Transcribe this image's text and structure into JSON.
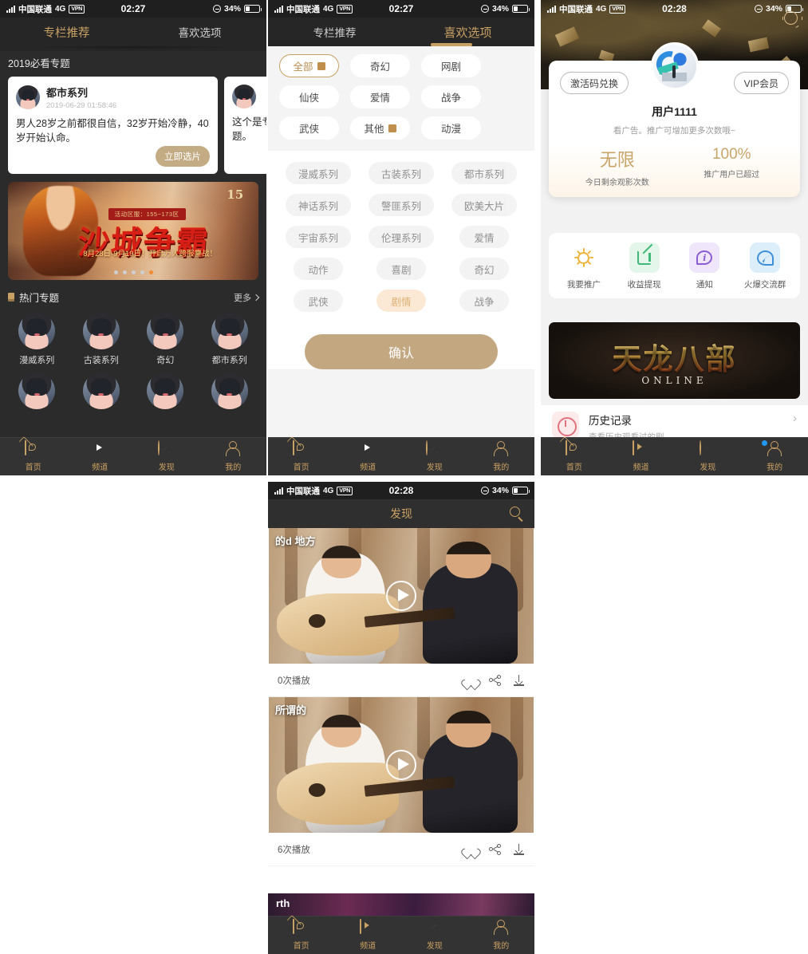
{
  "status_bar": {
    "carrier": "中国联通",
    "network": "4G",
    "vpn": "VPN",
    "time_227": "02:27",
    "time_228": "02:28",
    "battery": "34%"
  },
  "screen_home": {
    "tabs": [
      {
        "label": "专栏推荐",
        "active": true
      },
      {
        "label": "喜欢选项",
        "active": false
      }
    ],
    "section_title": "2019必看专题",
    "cards": [
      {
        "title": "都市系列",
        "date": "2019-06-29 01:58:46",
        "body": "男人28岁之前都很自信，32岁开始冷静，40岁开始认命。",
        "button": "立即选片"
      },
      {
        "body": "这个是专题。"
      }
    ],
    "banner": {
      "ribbon": "活动区服：155~173区",
      "title": "沙城争霸",
      "subtitle": "8月28日-9月19日！开启万人跨服鏖战！",
      "corner": "15",
      "dots": 5,
      "active_dot": 5
    },
    "hot_section": {
      "title": "热门专题",
      "more": "更多"
    },
    "hot_items": [
      {
        "label": "漫威系列"
      },
      {
        "label": "古装系列"
      },
      {
        "label": "奇幻"
      },
      {
        "label": "都市系列"
      }
    ],
    "nav": [
      {
        "label": "首页",
        "icon": "home-icon",
        "active": false
      },
      {
        "label": "频道",
        "icon": "channel-icon",
        "active": true
      },
      {
        "label": "发现",
        "icon": "discover-icon",
        "active": false
      },
      {
        "label": "我的",
        "icon": "profile-icon",
        "active": false
      }
    ]
  },
  "screen_prefs": {
    "tabs": [
      {
        "label": "专栏推荐",
        "active": false
      },
      {
        "label": "喜欢选项",
        "active": true
      }
    ],
    "top_chips": [
      {
        "label": "全部",
        "selected": true,
        "has_square": true
      },
      {
        "label": "奇幻",
        "selected": false,
        "has_square": false
      },
      {
        "label": "网剧",
        "selected": false,
        "has_square": false
      },
      {
        "label": "仙侠",
        "selected": false,
        "has_square": false
      },
      {
        "label": "爱情",
        "selected": false,
        "has_square": false
      },
      {
        "label": "战争",
        "selected": false,
        "has_square": false
      },
      {
        "label": "武侠",
        "selected": false,
        "has_square": false
      },
      {
        "label": "其他",
        "selected": false,
        "has_square": true
      },
      {
        "label": "动漫",
        "selected": false,
        "has_square": false
      }
    ],
    "body_chips": [
      {
        "label": "漫威系列",
        "selected": false
      },
      {
        "label": "古装系列",
        "selected": false
      },
      {
        "label": "都市系列",
        "selected": false
      },
      {
        "label": "神话系列",
        "selected": false
      },
      {
        "label": "警匪系列",
        "selected": false
      },
      {
        "label": "欧美大片",
        "selected": false
      },
      {
        "label": "宇宙系列",
        "selected": false
      },
      {
        "label": "伦理系列",
        "selected": false
      },
      {
        "label": "爱情",
        "selected": false
      },
      {
        "label": "动作",
        "selected": false
      },
      {
        "label": "喜剧",
        "selected": false
      },
      {
        "label": "奇幻",
        "selected": false
      },
      {
        "label": "武侠",
        "selected": false
      },
      {
        "label": "剧情",
        "selected": true
      },
      {
        "label": "战争",
        "selected": false
      }
    ],
    "confirm_label": "确认",
    "nav": [
      {
        "label": "首页",
        "icon": "home-icon",
        "active": false
      },
      {
        "label": "频道",
        "icon": "channel-icon",
        "active": true
      },
      {
        "label": "发现",
        "icon": "discover-icon",
        "active": false
      },
      {
        "label": "我的",
        "icon": "profile-icon",
        "active": false
      }
    ]
  },
  "screen_profile": {
    "gear_icon": "gear-icon",
    "redeem_button": "激活码兑换",
    "vip_button": "VIP会员",
    "username": "用户1111",
    "tagline": "看广告。推广可增加更多次数哦~",
    "stats": [
      {
        "value": "无限",
        "label": "今日剩余观影次数"
      },
      {
        "value": "100%",
        "label": "推广用户已超过"
      }
    ],
    "quick_actions": [
      {
        "label": "我要推广",
        "icon": "sun-icon"
      },
      {
        "label": "收益提现",
        "icon": "edit-icon"
      },
      {
        "label": "通知",
        "icon": "info-icon"
      },
      {
        "label": "火爆交流群",
        "icon": "rocket-icon"
      }
    ],
    "ad": {
      "title": "天龙八部",
      "subtitle": "ONLINE"
    },
    "history": {
      "title": "历史记录",
      "subtitle": "查看历史观看过的剧"
    },
    "nav": [
      {
        "label": "首页",
        "icon": "home-icon",
        "active": false
      },
      {
        "label": "频道",
        "icon": "channel-icon",
        "active": false
      },
      {
        "label": "发现",
        "icon": "discover-icon",
        "active": false
      },
      {
        "label": "我的",
        "icon": "profile-icon",
        "active": true
      }
    ]
  },
  "screen_discover": {
    "title": "发现",
    "search_icon": "search-icon",
    "videos": [
      {
        "tag": "的d 地方",
        "plays": "0次播放"
      },
      {
        "tag": "所谓的",
        "plays": "6次播放"
      },
      {
        "tag": "rth",
        "plays": ""
      }
    ],
    "actions": {
      "like": "heart-icon",
      "share": "share-icon",
      "download": "download-icon"
    },
    "nav": [
      {
        "label": "首页",
        "icon": "home-icon",
        "active": false
      },
      {
        "label": "频道",
        "icon": "channel-icon",
        "active": false
      },
      {
        "label": "发现",
        "icon": "discover-icon",
        "active": true
      },
      {
        "label": "我的",
        "icon": "profile-icon",
        "active": false
      }
    ]
  },
  "colors": {
    "gold": "#c9a063",
    "orange": "#f08a32",
    "button_tan": "#c3a781",
    "selected_chip_bg": "#fbe6cf",
    "dark_bg": "#2b2b2b",
    "nav_bg": "#333333"
  }
}
